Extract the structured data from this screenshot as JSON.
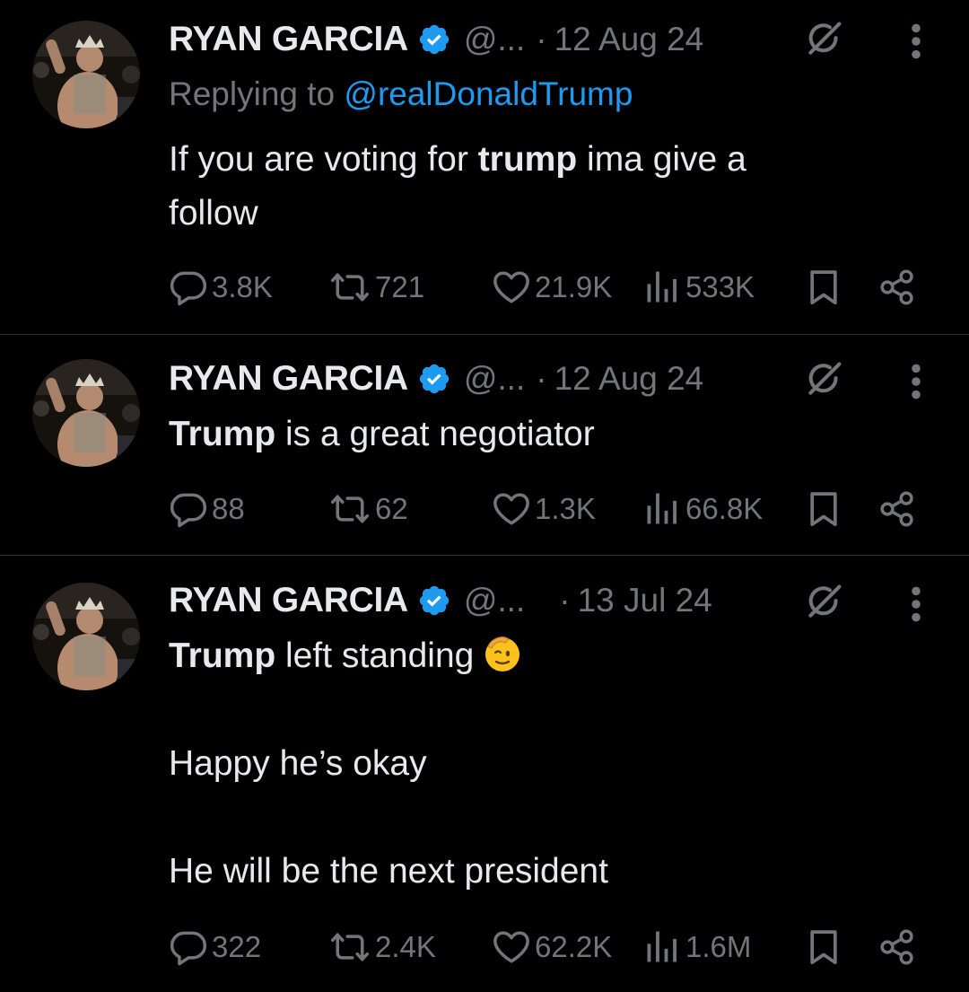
{
  "colors": {
    "background": "#000000",
    "text": "#e7e9ea",
    "muted": "#71767b",
    "accent": "#1d9bf0",
    "divider": "#2f3336"
  },
  "tweets": [
    {
      "author_name": "RYAN GARCIA",
      "handle": "@...",
      "separator": "·",
      "date": "12 Aug 24",
      "replying_prefix": "Replying to",
      "replying_to": "@realDonaldTrump",
      "text_parts": {
        "a": "If you are voting for ",
        "b": "trump",
        "c": " ima give a",
        "d": "follow"
      },
      "replies": "3.8K",
      "reposts": "721",
      "likes": "21.9K",
      "views": "533K",
      "icons": [
        "verified-badge-icon",
        "grok-icon",
        "more-icon",
        "reply-icon",
        "repost-icon",
        "like-icon",
        "views-icon",
        "bookmark-icon",
        "share-icon"
      ]
    },
    {
      "author_name": "RYAN GARCIA",
      "handle": "@...",
      "separator": "·",
      "date": "12 Aug 24",
      "text_parts": {
        "a": "Trump",
        "b": " is a great negotiator"
      },
      "replies": "88",
      "reposts": "62",
      "likes": "1.3K",
      "views": "66.8K"
    },
    {
      "author_name": "RYAN GARCIA",
      "handle": "@...",
      "separator": "·",
      "date": "13 Jul 24",
      "text_parts": {
        "a": "Trump",
        "b": " left standing",
        "emoji": "saluting-face-emoji",
        "c": "Happy he’s okay",
        "d": "He will be the next president"
      },
      "replies": "322",
      "reposts": "2.4K",
      "likes": "62.2K",
      "views": "1.6M"
    }
  ]
}
